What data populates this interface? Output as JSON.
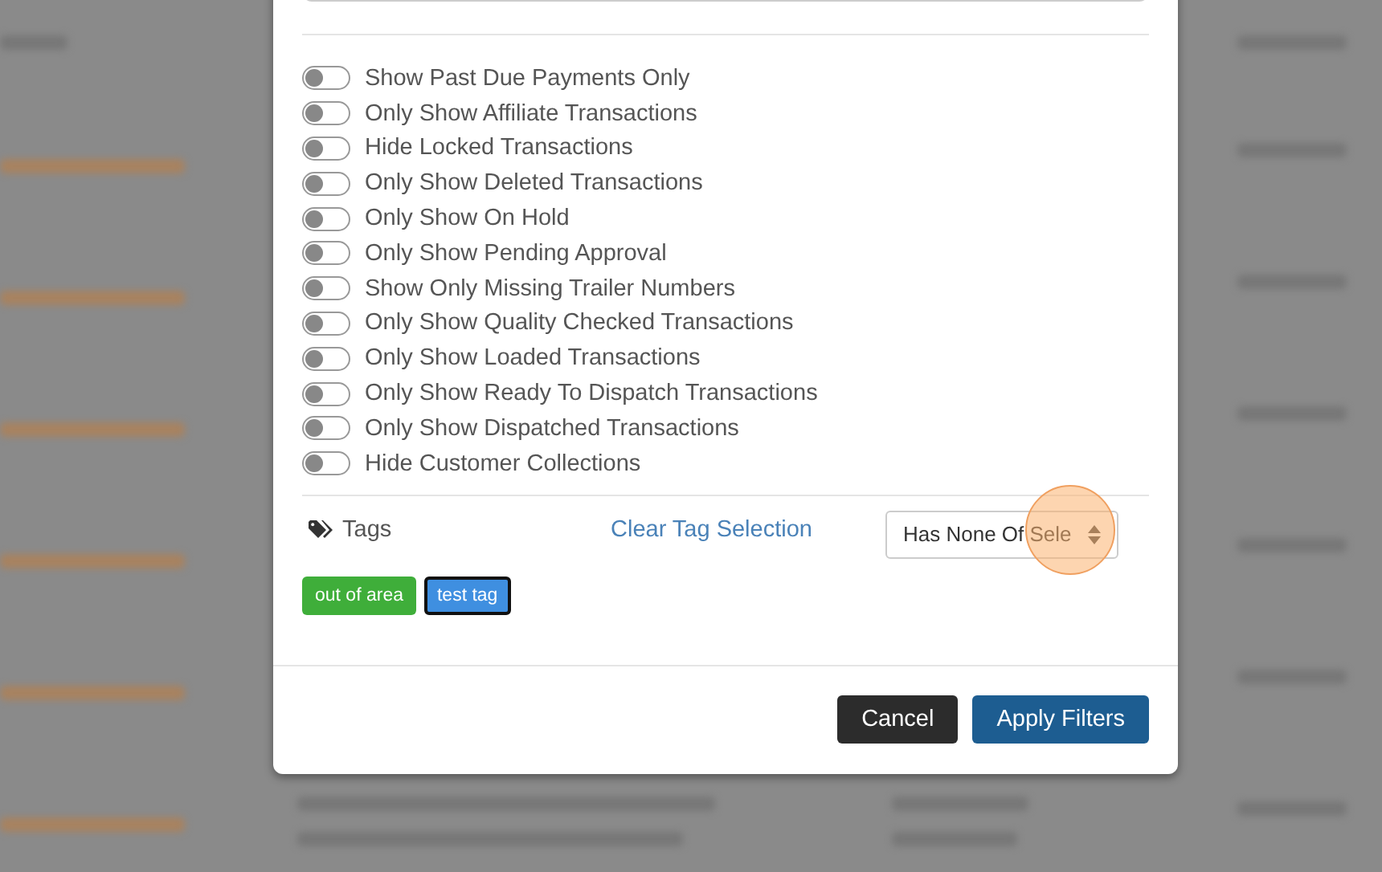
{
  "filters": [
    {
      "label": "Show Past Due Payments Only",
      "on": false
    },
    {
      "label": "Only Show Affiliate Transactions",
      "on": false
    },
    {
      "label": "Hide Locked Transactions",
      "on": false
    },
    {
      "label": "Only Show Deleted Transactions",
      "on": false
    },
    {
      "label": "Only Show On Hold",
      "on": false
    },
    {
      "label": "Only Show Pending Approval",
      "on": false
    },
    {
      "label": "Show Only Missing Trailer Numbers",
      "on": false
    },
    {
      "label": "Only Show Quality Checked Transactions",
      "on": false
    },
    {
      "label": "Only Show Loaded Transactions",
      "on": false
    },
    {
      "label": "Only Show Ready To Dispatch Transactions",
      "on": false
    },
    {
      "label": "Only Show Dispatched Transactions",
      "on": false
    },
    {
      "label": "Hide Customer Collections",
      "on": false
    }
  ],
  "tags_section": {
    "title": "Tags",
    "clear_link": "Clear Tag Selection",
    "match_select": "Has None Of Sele",
    "tags": [
      {
        "label": "out of area",
        "color": "#3fae3a",
        "selected": false
      },
      {
        "label": "test tag",
        "color": "#3f8fe0",
        "selected": true
      }
    ]
  },
  "buttons": [
    {
      "label": "Cancel",
      "kind": "secondary"
    },
    {
      "label": "Apply Filters",
      "kind": "primary"
    }
  ]
}
